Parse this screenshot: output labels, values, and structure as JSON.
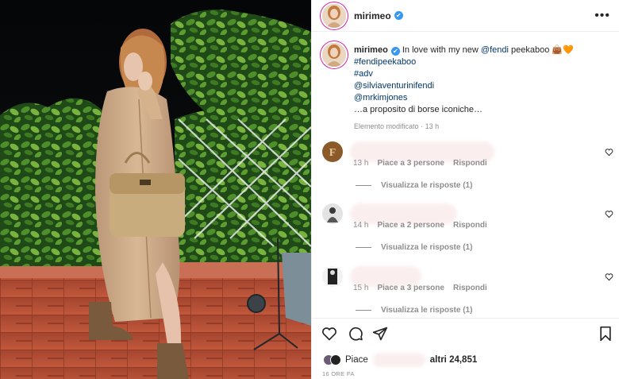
{
  "post": {
    "username": "mirimeo",
    "verified_mark": "✔",
    "more_label": "•••"
  },
  "caption": {
    "username": "mirimeo",
    "text_intro": "In love with my new",
    "mention_brand": "@fendi",
    "text_tail": "peekaboo",
    "emojis": "👜🧡",
    "hashtag_1": "#fendipeekaboo",
    "hashtag_2": "#adv",
    "mention_1": "@silviaventurinifendi",
    "mention_2": "@mrkimjones",
    "closing": "…a proposito di borse iconiche…",
    "edited_label": "Elemento modificato",
    "edited_time": "13 h",
    "separator": "·"
  },
  "comments": [
    {
      "time": "13 h",
      "likes": "Piace a 3 persone",
      "reply": "Rispondi",
      "view_replies": "Visualizza le risposte (1)",
      "avatar_icon": "fendi-monogram-avatar"
    },
    {
      "time": "14 h",
      "likes": "Piace a 2 persone",
      "reply": "Rispondi",
      "view_replies": "Visualizza le risposte (1)",
      "avatar_icon": "person-avatar"
    },
    {
      "time": "15 h",
      "likes": "Piace a 3 persone",
      "reply": "Rispondi",
      "view_replies": "Visualizza le risposte (1)",
      "avatar_icon": "bw-person-avatar"
    }
  ],
  "footer": {
    "likes_prefix": "Piace",
    "likes_suffix": "altri 24,851",
    "time_ago": "16 ORE FA"
  },
  "icons": [
    "heart-icon",
    "comment-icon",
    "share-icon",
    "bookmark-icon",
    "more-icon",
    "verified-icon"
  ],
  "colors": {
    "link": "#00376b",
    "verified": "#3897f0",
    "muted": "#8e8e8e",
    "text": "#262626"
  }
}
